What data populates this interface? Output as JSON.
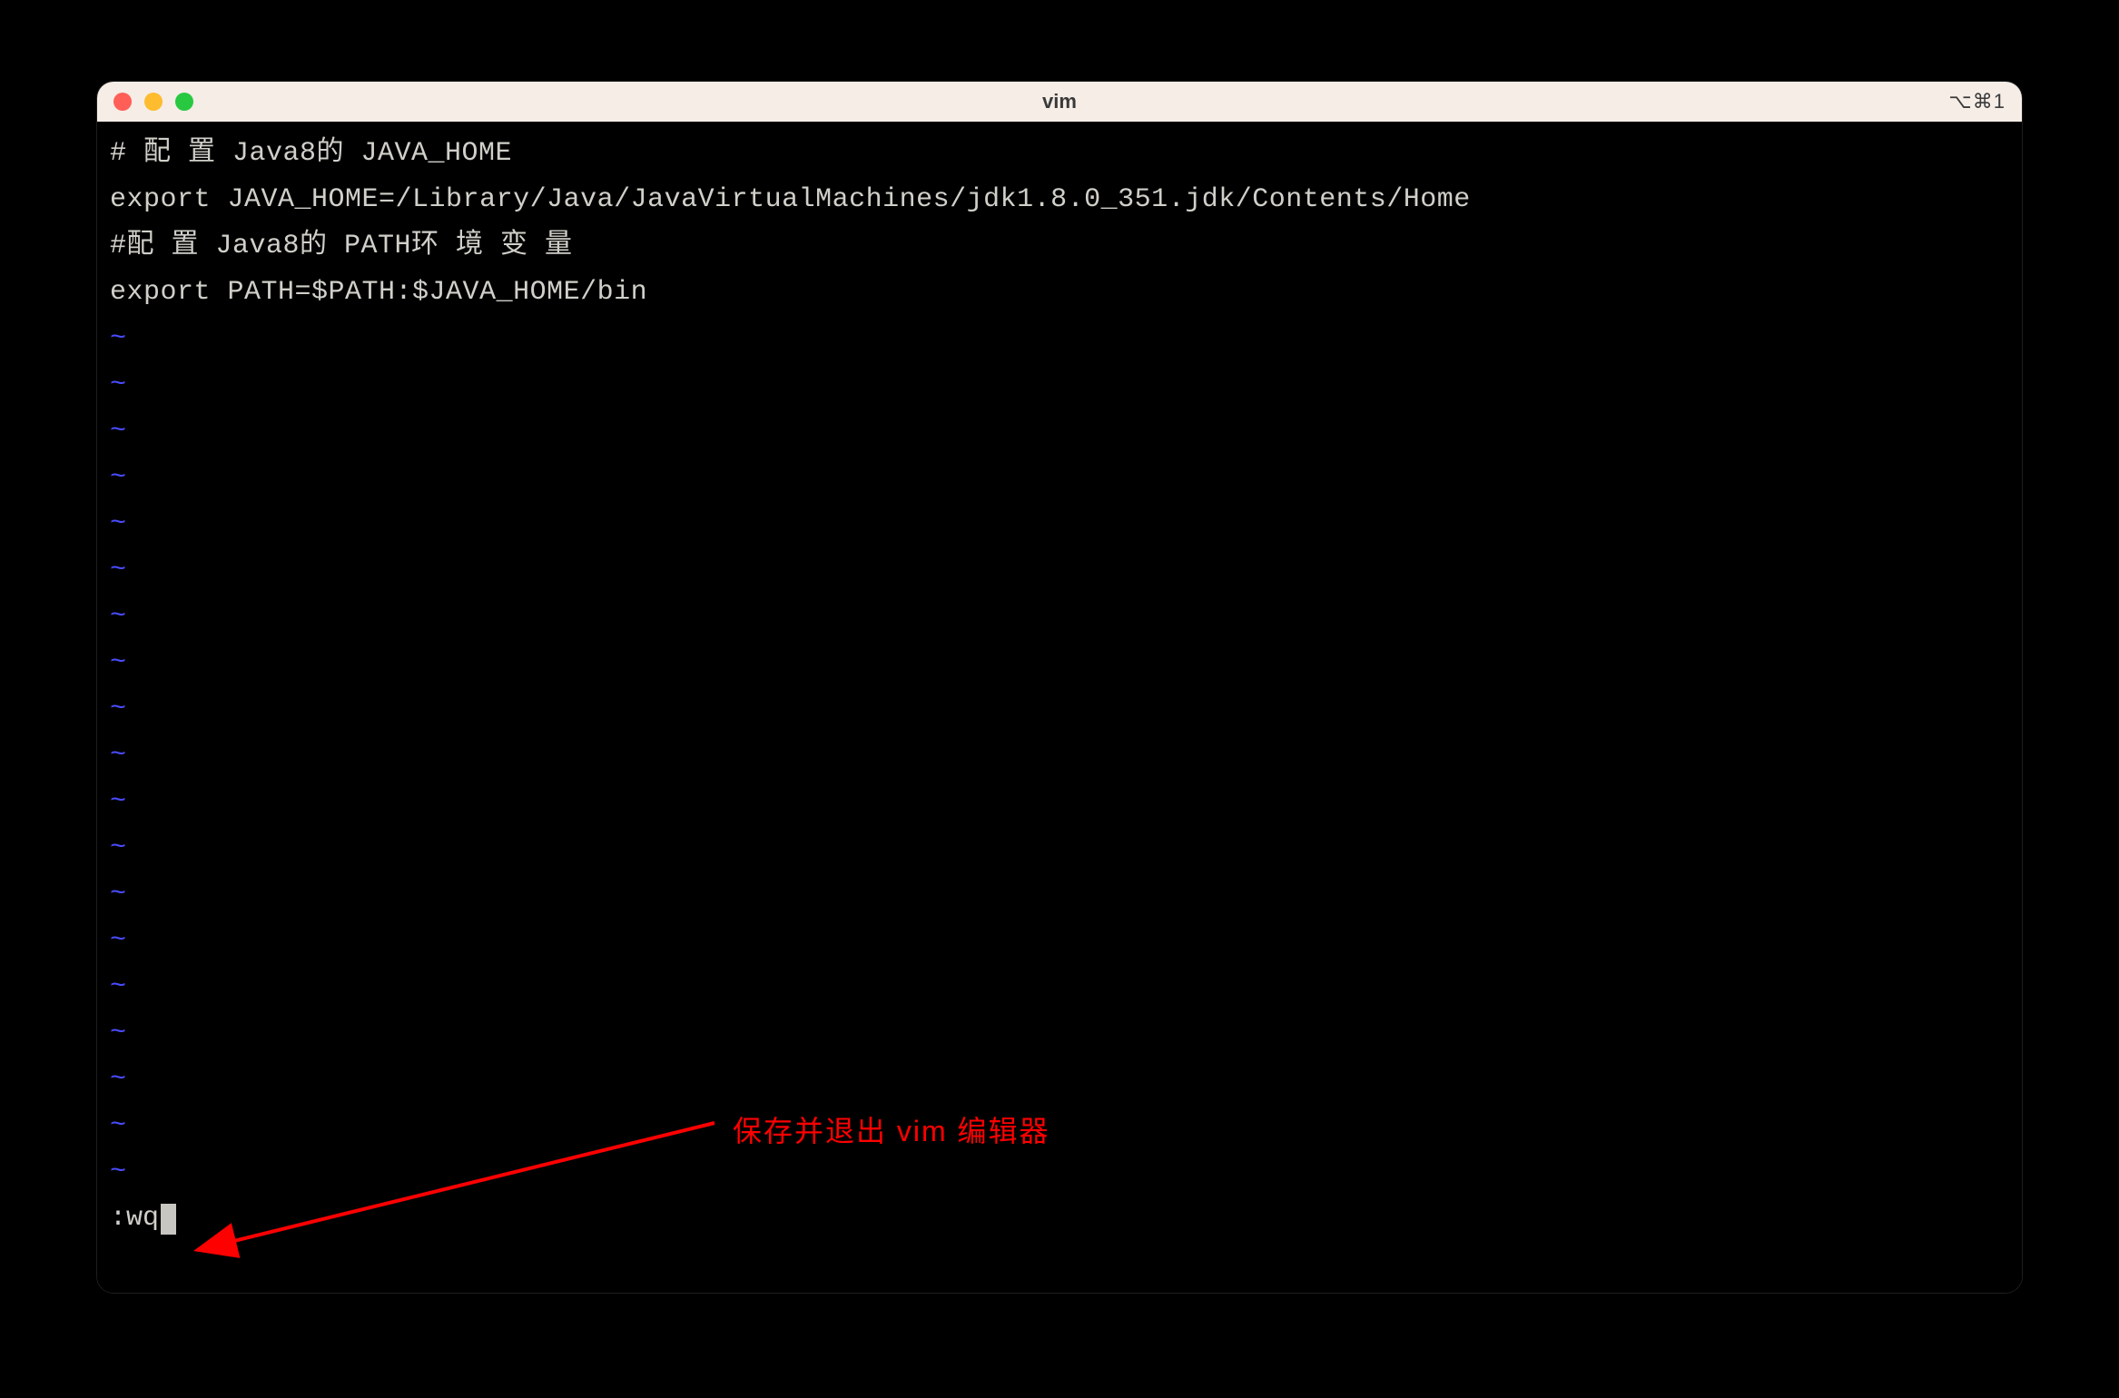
{
  "window": {
    "title": "vim",
    "shortcut": "⌥⌘1"
  },
  "content": {
    "lines": [
      "# 配 置 Java8的 JAVA_HOME",
      "export JAVA_HOME=/Library/Java/JavaVirtualMachines/jdk1.8.0_351.jdk/Contents/Home",
      "#配 置 Java8的 PATH环 境 变 量",
      "export PATH=$PATH:$JAVA_HOME/bin"
    ],
    "tilde": "~",
    "tilde_count": 19,
    "command": ":wq"
  },
  "annotation": {
    "text": "保存并退出 vim 编辑器"
  }
}
